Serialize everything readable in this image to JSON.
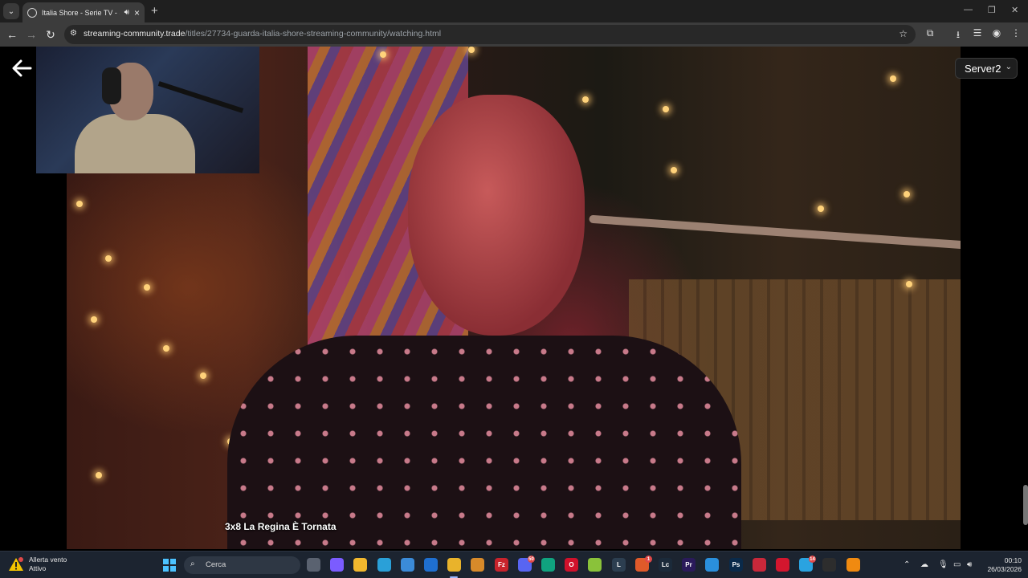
{
  "browser": {
    "tab_title": "Italia Shore - Serie TV - Streaming Community",
    "url_host": "streaming-community.trade",
    "url_path": "/titles/27734-guarda-italia-shore-streaming-community/watching.html"
  },
  "player": {
    "server_selected": "Server2",
    "subtitle": "3x8 La Regina È Tornata"
  },
  "taskbar": {
    "weather_title": "Allerta vento",
    "weather_status": "Attivo",
    "search_placeholder": "Cerca",
    "apps": [
      {
        "name": "task-view",
        "label": "",
        "color": "#5a6270"
      },
      {
        "name": "copilot",
        "label": "",
        "color": "#7b5cff"
      },
      {
        "name": "file-explorer",
        "label": "",
        "color": "#f2b82e"
      },
      {
        "name": "edge",
        "label": "",
        "color": "#2aa0d8"
      },
      {
        "name": "microsoft-store",
        "label": "",
        "color": "#3b8bd8"
      },
      {
        "name": "outlook",
        "label": "",
        "color": "#1f6fd0"
      },
      {
        "name": "chrome",
        "label": "",
        "color": "#e9b32b"
      },
      {
        "name": "folder-app",
        "label": "",
        "color": "#d88a2a"
      },
      {
        "name": "filezilla",
        "label": "Fz",
        "color": "#c8232c"
      },
      {
        "name": "discord",
        "label": "",
        "color": "#5865f2"
      },
      {
        "name": "chatgpt",
        "label": "",
        "color": "#10a37f"
      },
      {
        "name": "opera",
        "label": "O",
        "color": "#d0112b"
      },
      {
        "name": "notepad-plus",
        "label": "",
        "color": "#8ac23a"
      },
      {
        "name": "li-app",
        "label": "L",
        "color": "#2c3e50"
      },
      {
        "name": "firefox-alt",
        "label": "",
        "color": "#e05a2a"
      },
      {
        "name": "lc-app",
        "label": "Lc",
        "color": "#1b2a3a"
      },
      {
        "name": "premiere",
        "label": "Pr",
        "color": "#2a1a5a"
      },
      {
        "name": "vscode",
        "label": "",
        "color": "#2a8fdc"
      },
      {
        "name": "photoshop",
        "label": "Ps",
        "color": "#0a2a4a"
      },
      {
        "name": "streamlabs",
        "label": "",
        "color": "#c9283a"
      },
      {
        "name": "obs-record",
        "label": "",
        "color": "#d3162e"
      },
      {
        "name": "telegram",
        "label": "",
        "color": "#2aa3e0"
      },
      {
        "name": "terminal",
        "label": "",
        "color": "#2d2d2d"
      },
      {
        "name": "vlc",
        "label": "",
        "color": "#f08a10"
      }
    ],
    "app_badges": {
      "discord": "50",
      "firefox-alt": "1",
      "telegram": "14"
    },
    "time": "00:10",
    "date": "26/03/2026"
  }
}
